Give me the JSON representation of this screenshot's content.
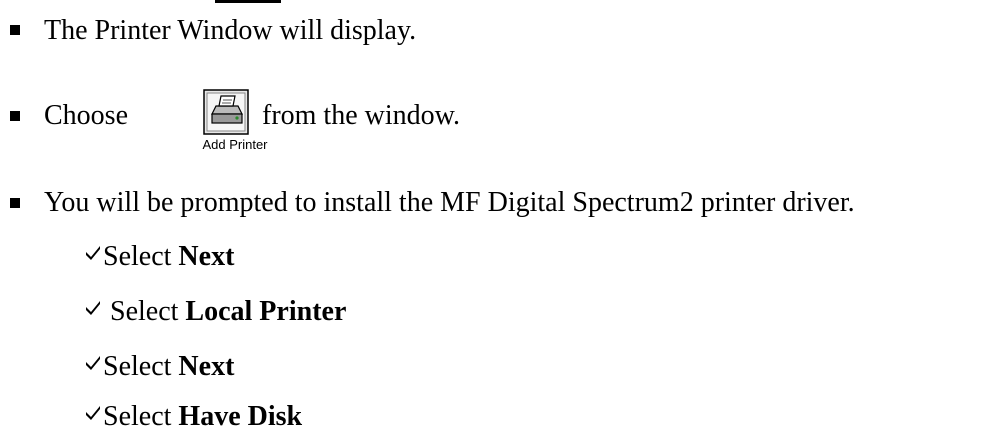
{
  "lines": [
    {
      "text": "The Printer Window will display."
    },
    {
      "before": "Choose",
      "icon_label": "Add Printer",
      "after": "from the window."
    },
    {
      "text": "You will be prompted to install the MF Digital Spectrum2 printer driver."
    }
  ],
  "steps": [
    {
      "prefix": "Select ",
      "bold": "Next"
    },
    {
      "prefix": " Select ",
      "bold": "Local Printer"
    },
    {
      "prefix": "Select ",
      "bold": "Next"
    },
    {
      "prefix": "Select ",
      "bold": "Have Disk"
    }
  ],
  "icon": "add-printer-icon"
}
